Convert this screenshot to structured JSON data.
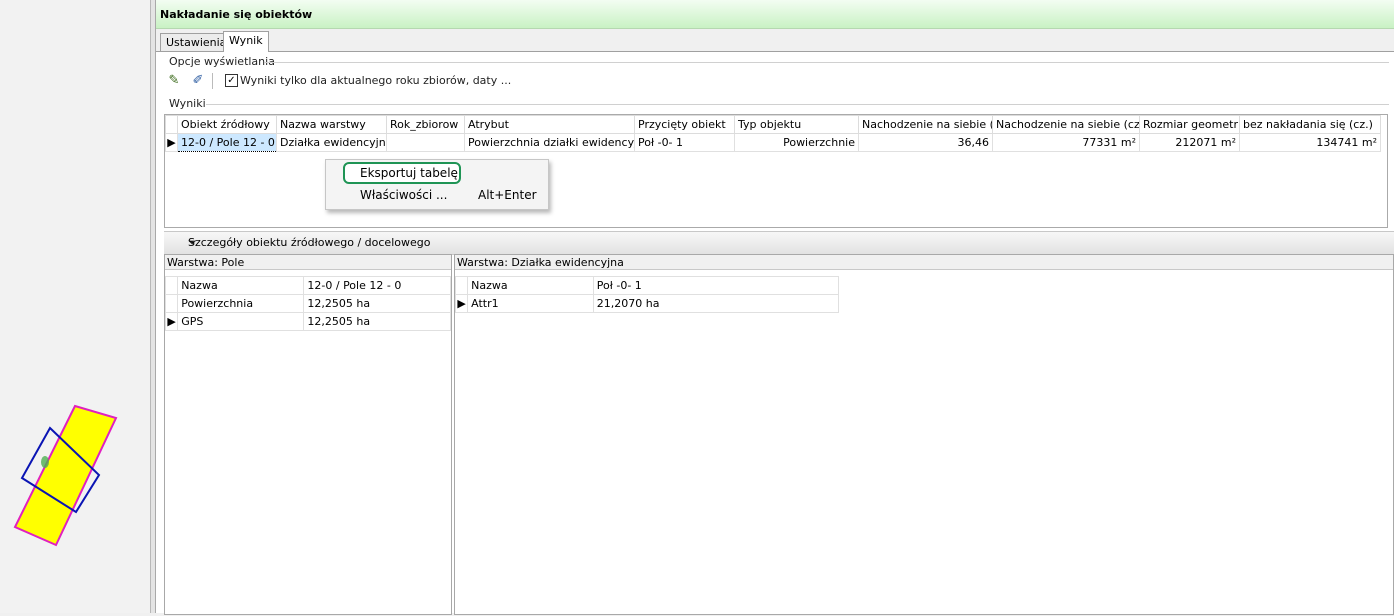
{
  "window": {
    "title": "Nakładanie się obiektów"
  },
  "tabs": [
    {
      "label": "Ustawienia"
    },
    {
      "label": "Wynik"
    }
  ],
  "display_options": {
    "label": "Opcje wyświetlania",
    "checkbox_label": "Wyniki tylko dla aktualnego roku zbiorów, daty ...",
    "checked": true,
    "icons": [
      "edit-check-icon",
      "edit-select-icon"
    ]
  },
  "results": {
    "label": "Wyniki",
    "columns": [
      "Obiekt źródłowy",
      "Nazwa warstwy",
      "Rok_zbiorow",
      "Atrybut",
      "Przycięty obiekt",
      "Typ objektu",
      "Nachodzenie na siebie (%)",
      "Nachodzenie na siebie (cz.)",
      "Rozmiar geometrii",
      "bez nakładania się (cz.)"
    ],
    "rows": [
      [
        "12-0 / Pole 12 - 0",
        "Działka ewidencyjna",
        "",
        "Powierzchnia działki ewidencyjnej",
        "Poł -0- 1",
        "Powierzchnie",
        "36,46",
        "77331 m²",
        "212071 m²",
        "134741 m²"
      ]
    ]
  },
  "context_menu": {
    "items": [
      {
        "label": "Eksportuj tabelę",
        "shortcut": ""
      },
      {
        "label": "Właściwości ...",
        "shortcut": "Alt+Enter"
      }
    ]
  },
  "details": {
    "label": "Szczegóły obiektu źródłowego / docelowego",
    "source": {
      "header": "Warstwa: Pole",
      "rows": [
        [
          "Nazwa",
          "12-0 / Pole 12 - 0"
        ],
        [
          "Powierzchnia",
          "12,2505 ha"
        ],
        [
          "GPS",
          "12,2505 ha"
        ]
      ]
    },
    "target": {
      "header": "Warstwa: Działka ewidencyjna",
      "rows": [
        [
          "Nazwa",
          "Poł -0- 1"
        ],
        [
          "Attr1",
          "21,2070 ha"
        ]
      ]
    }
  },
  "colors": {
    "title_bar": "#c9f2c4",
    "selection": "#cde8ff",
    "highlight": "#1f9455",
    "parcel_fill": "#ffff00",
    "parcel_border": "#e020c0",
    "overlay_border": "#0a14b4"
  }
}
